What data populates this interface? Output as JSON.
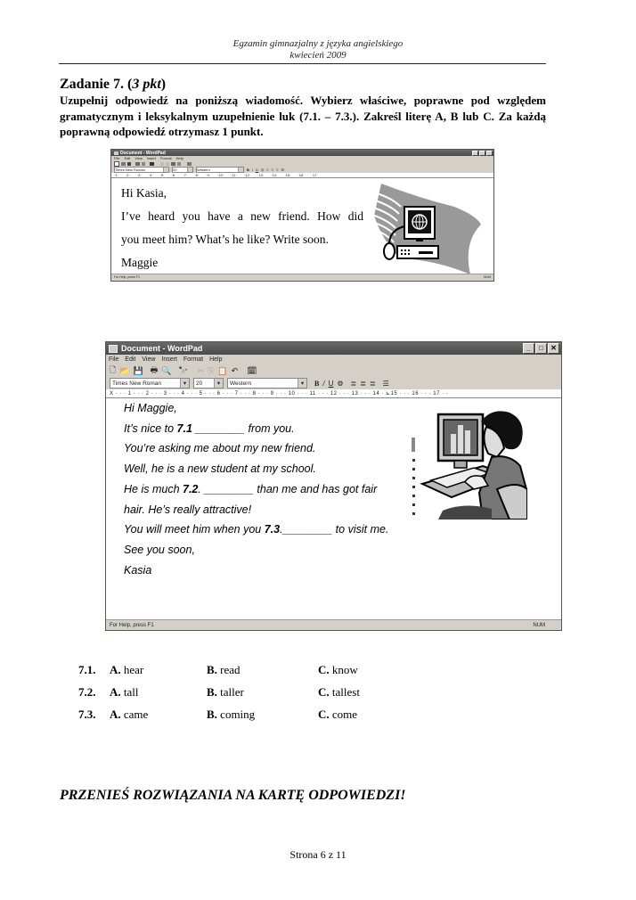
{
  "header": {
    "line1": "Egzamin gimnazjalny z języka angielskiego",
    "line2": "kwiecień 2009"
  },
  "task": {
    "title": "Zadanie 7. (",
    "points": "3 pkt",
    "title_close": ")",
    "instruction": "Uzupełnij odpowiedź na poniższą wiadomość. Wybierz właściwe, poprawne pod względem gramatycznym i leksykalnym uzupełnienie luk (7.1. – 7.3.). Zakreśl literę A, B lub C. Za każdą poprawną odpowiedź otrzymasz 1 punkt."
  },
  "window1": {
    "title": "Document - WordPad",
    "menu": [
      "File",
      "Edit",
      "View",
      "Insert",
      "Format",
      "Help"
    ],
    "font": "Times New Roman",
    "size": "20",
    "script": "Western",
    "status": "For Help, press F1",
    "status_right": "NUM",
    "letter": {
      "greeting": "Hi Kasia,",
      "line1": "I’ve heard you have a new friend. How did",
      "line2": "you meet him? What’s he like? Write soon.",
      "sign": "Maggie"
    }
  },
  "window2": {
    "title": "Document - WordPad",
    "menu": [
      "File",
      "Edit",
      "View",
      "Insert",
      "Format",
      "Help"
    ],
    "font": "Times New Roman",
    "size": "20",
    "script": "Western",
    "ruler": "X · · · 1 · · · 2 · · · 3 · · · 4 · · · 5 · · · 6 · · · 7 · · · 8 · · · 9 · · · 10 · · · 11 · · · 12 · · · 13 · · · 14 · ⊾15 · · · 16 · · · 17 · ·",
    "status": "For Help, press F1",
    "status_right": "NUM",
    "letter": {
      "greeting": "Hi Maggie,",
      "l1_pre": "It’s nice to ",
      "l1_gap": "7.1",
      "l1_post": " ________ from you.",
      "l2": "You’re asking me about my new friend.",
      "l3": "Well, he is a new student at my school.",
      "l4_pre": "He is much ",
      "l4_gap": "7.2",
      "l4_post": ". ________ than me and has got fair",
      "l5": "hair. He’s really attractive!",
      "l6_pre": "You will meet him when you ",
      "l6_gap": "7.3",
      "l6_post": ".________ to visit me.",
      "l7": "See you soon,",
      "sign": "Kasia"
    }
  },
  "options": [
    {
      "num": "7.1.",
      "a": "hear",
      "b": "read",
      "c": "know"
    },
    {
      "num": "7.2.",
      "a": "tall",
      "b": "taller",
      "c": "tallest"
    },
    {
      "num": "7.3.",
      "a": "came",
      "b": "coming",
      "c": "come"
    }
  ],
  "option_letters": {
    "a": "A.",
    "b": "B.",
    "c": "C."
  },
  "footer_note": "PRZENIEŚ ROZWIĄZANIA NA KARTĘ ODPOWIEDZI!",
  "page": "Strona 6 z 11"
}
